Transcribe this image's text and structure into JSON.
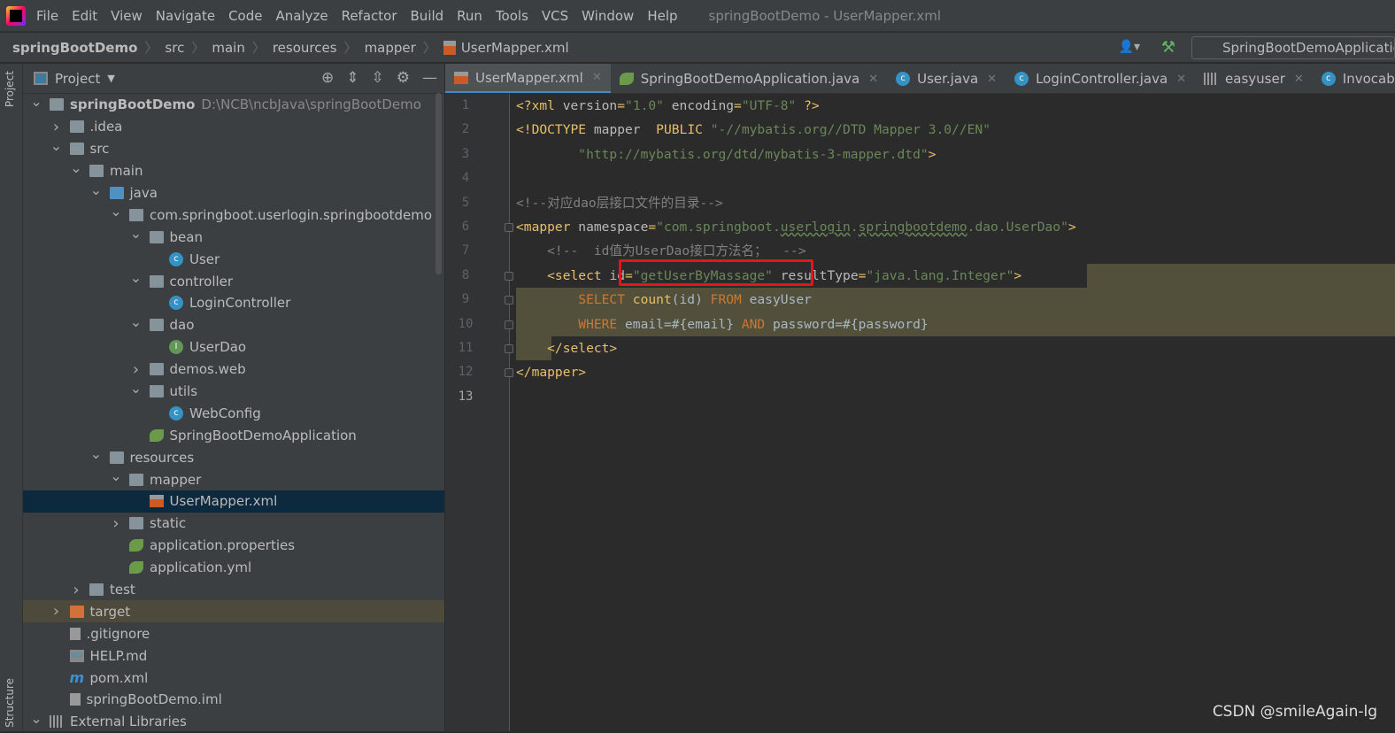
{
  "menu": {
    "items": [
      "File",
      "Edit",
      "View",
      "Navigate",
      "Code",
      "Analyze",
      "Refactor",
      "Build",
      "Run",
      "Tools",
      "VCS",
      "Window",
      "Help"
    ],
    "window_title": "springBootDemo - UserMapper.xml"
  },
  "breadcrumb": [
    "springBootDemo",
    "src",
    "main",
    "resources",
    "mapper",
    "UserMapper.xml"
  ],
  "toolbar": {
    "run_config": "SpringBootDemoApplication"
  },
  "side": {
    "project": "Project",
    "structure": "Structure"
  },
  "project_panel": {
    "title": "Project",
    "tree": [
      {
        "level": 0,
        "arrow": "down",
        "icon": "module",
        "label": "springBootDemo",
        "path": "D:\\NCB\\ncbJava\\springBootDemo",
        "bold": true
      },
      {
        "level": 1,
        "arrow": "right",
        "icon": "folder",
        "label": ".idea"
      },
      {
        "level": 1,
        "arrow": "down",
        "icon": "folder",
        "label": "src"
      },
      {
        "level": 2,
        "arrow": "down",
        "icon": "folder",
        "label": "main"
      },
      {
        "level": 3,
        "arrow": "down",
        "icon": "folder-blue",
        "label": "java"
      },
      {
        "level": 4,
        "arrow": "down",
        "icon": "pkg",
        "label": "com.springboot.userlogin.springbootdemo"
      },
      {
        "level": 5,
        "arrow": "down",
        "icon": "pkg",
        "label": "bean"
      },
      {
        "level": 6,
        "arrow": "",
        "icon": "cls",
        "label": "User"
      },
      {
        "level": 5,
        "arrow": "down",
        "icon": "pkg",
        "label": "controller"
      },
      {
        "level": 6,
        "arrow": "",
        "icon": "cls",
        "label": "LoginController"
      },
      {
        "level": 5,
        "arrow": "down",
        "icon": "pkg",
        "label": "dao"
      },
      {
        "level": 6,
        "arrow": "",
        "icon": "intf",
        "label": "UserDao"
      },
      {
        "level": 5,
        "arrow": "right",
        "icon": "pkg",
        "label": "demos.web"
      },
      {
        "level": 5,
        "arrow": "down",
        "icon": "pkg",
        "label": "utils"
      },
      {
        "level": 6,
        "arrow": "",
        "icon": "cls",
        "label": "WebConfig"
      },
      {
        "level": 5,
        "arrow": "",
        "icon": "spring",
        "label": "SpringBootDemoApplication"
      },
      {
        "level": 3,
        "arrow": "down",
        "icon": "folder",
        "label": "resources"
      },
      {
        "level": 4,
        "arrow": "down",
        "icon": "folder",
        "label": "mapper"
      },
      {
        "level": 5,
        "arrow": "",
        "icon": "xml",
        "label": "UserMapper.xml",
        "selected": true
      },
      {
        "level": 4,
        "arrow": "right",
        "icon": "folder",
        "label": "static"
      },
      {
        "level": 4,
        "arrow": "",
        "icon": "spring",
        "label": "application.properties"
      },
      {
        "level": 4,
        "arrow": "",
        "icon": "spring",
        "label": "application.yml"
      },
      {
        "level": 2,
        "arrow": "right",
        "icon": "folder",
        "label": "test"
      },
      {
        "level": 1,
        "arrow": "right",
        "icon": "folder-orange",
        "label": "target",
        "excluded": true
      },
      {
        "level": 1,
        "arrow": "",
        "icon": "file",
        "label": ".gitignore"
      },
      {
        "level": 1,
        "arrow": "",
        "icon": "md",
        "label": "HELP.md"
      },
      {
        "level": 1,
        "arrow": "",
        "icon": "m",
        "label": "pom.xml"
      },
      {
        "level": 1,
        "arrow": "",
        "icon": "file",
        "label": "springBootDemo.iml"
      },
      {
        "level": 0,
        "arrow": "down",
        "icon": "lib",
        "label": "External Libraries"
      }
    ]
  },
  "tabs": [
    {
      "label": "UserMapper.xml",
      "icon": "xml",
      "active": true
    },
    {
      "label": "SpringBootDemoApplication.java",
      "icon": "spring"
    },
    {
      "label": "User.java",
      "icon": "cls"
    },
    {
      "label": "LoginController.java",
      "icon": "cls"
    },
    {
      "label": "easyuser",
      "icon": "table"
    },
    {
      "label": "InvocableHandlerMethod",
      "icon": "cls"
    }
  ],
  "editor": {
    "current_line": 13,
    "lines": [
      [
        [
          "tag",
          "<?xml "
        ],
        [
          "attr",
          "version"
        ],
        [
          "tag",
          "="
        ],
        [
          "val",
          "\"1.0\""
        ],
        [
          "attr",
          " encoding"
        ],
        [
          "tag",
          "="
        ],
        [
          "val",
          "\"UTF-8\""
        ],
        [
          "tag",
          " ?>"
        ]
      ],
      [
        [
          "tag",
          "<!DOCTYPE "
        ],
        [
          "attr",
          "mapper  "
        ],
        [
          "tag",
          "PUBLIC "
        ],
        [
          "val",
          "\"-//mybatis.org//DTD Mapper 3.0//EN\""
        ]
      ],
      [
        [
          "val",
          "        \"http://mybatis.org/dtd/mybatis-3-mapper.dtd\""
        ],
        [
          "tag",
          ">"
        ]
      ],
      [],
      [
        [
          "com",
          "<!--对应dao层接口文件的目录-->"
        ]
      ],
      [
        [
          "tag",
          "<mapper "
        ],
        [
          "attr",
          "namespace"
        ],
        [
          "tag",
          "="
        ],
        [
          "val",
          "\"com.springboot."
        ],
        [
          "und",
          "userlogin"
        ],
        [
          "val",
          "."
        ],
        [
          "und",
          "springbootdemo"
        ],
        [
          "val",
          ".dao.UserDao\""
        ],
        [
          "tag",
          ">"
        ]
      ],
      [
        [
          "com",
          "    <!--  id值为UserDao接口方法名；  -->"
        ]
      ],
      [
        [
          "tag",
          "    <select "
        ],
        [
          "attr",
          "id"
        ],
        [
          "tag",
          "="
        ],
        [
          "val",
          "\"getUserByMassage\""
        ],
        [
          "attr",
          " resultType"
        ],
        [
          "tag",
          "="
        ],
        [
          "val",
          "\"java.lang.Integer\""
        ],
        [
          "tag",
          ">"
        ]
      ],
      [
        [
          "kw",
          "        SELECT "
        ],
        [
          "tag",
          "count"
        ],
        [
          "txt",
          "(id) "
        ],
        [
          "kw",
          "FROM "
        ],
        [
          "txt",
          "easyUser"
        ]
      ],
      [
        [
          "kw",
          "        WHERE "
        ],
        [
          "txt",
          "email=#{email} "
        ],
        [
          "kw",
          "AND "
        ],
        [
          "txt",
          "password=#{password}"
        ]
      ],
      [
        [
          "tag",
          "    </select>"
        ]
      ],
      [
        [
          "tag",
          "</mapper>"
        ]
      ],
      []
    ]
  },
  "watermark": "CSDN @smileAgain-lg"
}
